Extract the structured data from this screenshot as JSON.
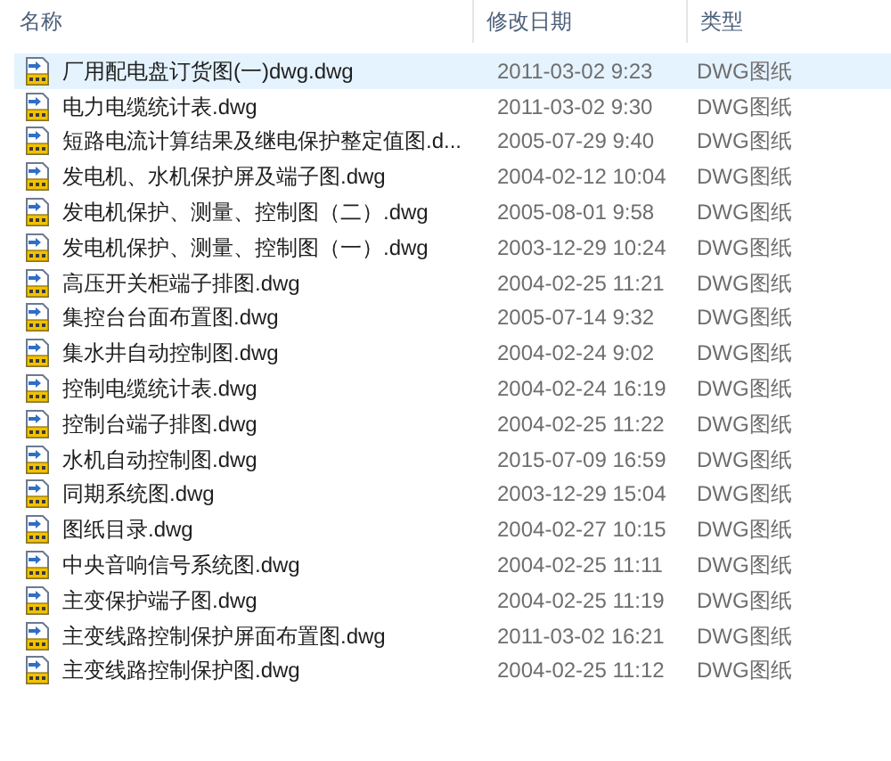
{
  "columns": [
    "名称",
    "修改日期",
    "类型"
  ],
  "files": [
    {
      "name": "厂用配电盘订货图(一)dwg.dwg",
      "modified": "2011-03-02 9:23",
      "type": "DWG图纸",
      "selected": true
    },
    {
      "name": "电力电缆统计表.dwg",
      "modified": "2011-03-02 9:30",
      "type": "DWG图纸",
      "selected": false
    },
    {
      "name": "短路电流计算结果及继电保护整定值图.d...",
      "modified": "2005-07-29 9:40",
      "type": "DWG图纸",
      "selected": false
    },
    {
      "name": "发电机、水机保护屏及端子图.dwg",
      "modified": "2004-02-12 10:04",
      "type": "DWG图纸",
      "selected": false
    },
    {
      "name": "发电机保护、测量、控制图（二）.dwg",
      "modified": "2005-08-01 9:58",
      "type": "DWG图纸",
      "selected": false
    },
    {
      "name": "发电机保护、测量、控制图（一）.dwg",
      "modified": "2003-12-29 10:24",
      "type": "DWG图纸",
      "selected": false
    },
    {
      "name": "高压开关柜端子排图.dwg",
      "modified": "2004-02-25 11:21",
      "type": "DWG图纸",
      "selected": false
    },
    {
      "name": "集控台台面布置图.dwg",
      "modified": "2005-07-14 9:32",
      "type": "DWG图纸",
      "selected": false
    },
    {
      "name": "集水井自动控制图.dwg",
      "modified": "2004-02-24 9:02",
      "type": "DWG图纸",
      "selected": false
    },
    {
      "name": "控制电缆统计表.dwg",
      "modified": "2004-02-24 16:19",
      "type": "DWG图纸",
      "selected": false
    },
    {
      "name": "控制台端子排图.dwg",
      "modified": "2004-02-25 11:22",
      "type": "DWG图纸",
      "selected": false
    },
    {
      "name": "水机自动控制图.dwg",
      "modified": "2015-07-09 16:59",
      "type": "DWG图纸",
      "selected": false
    },
    {
      "name": "同期系统图.dwg",
      "modified": "2003-12-29 15:04",
      "type": "DWG图纸",
      "selected": false
    },
    {
      "name": "图纸目录.dwg",
      "modified": "2004-02-27 10:15",
      "type": "DWG图纸",
      "selected": false
    },
    {
      "name": "中央音响信号系统图.dwg",
      "modified": "2004-02-25 11:11",
      "type": "DWG图纸",
      "selected": false
    },
    {
      "name": "主变保护端子图.dwg",
      "modified": "2004-02-25 11:19",
      "type": "DWG图纸",
      "selected": false
    },
    {
      "name": "主变线路控制保护屏面布置图.dwg",
      "modified": "2011-03-02 16:21",
      "type": "DWG图纸",
      "selected": false
    },
    {
      "name": "主变线路控制保护图.dwg",
      "modified": "2004-02-25 11:12",
      "type": "DWG图纸",
      "selected": false
    }
  ]
}
